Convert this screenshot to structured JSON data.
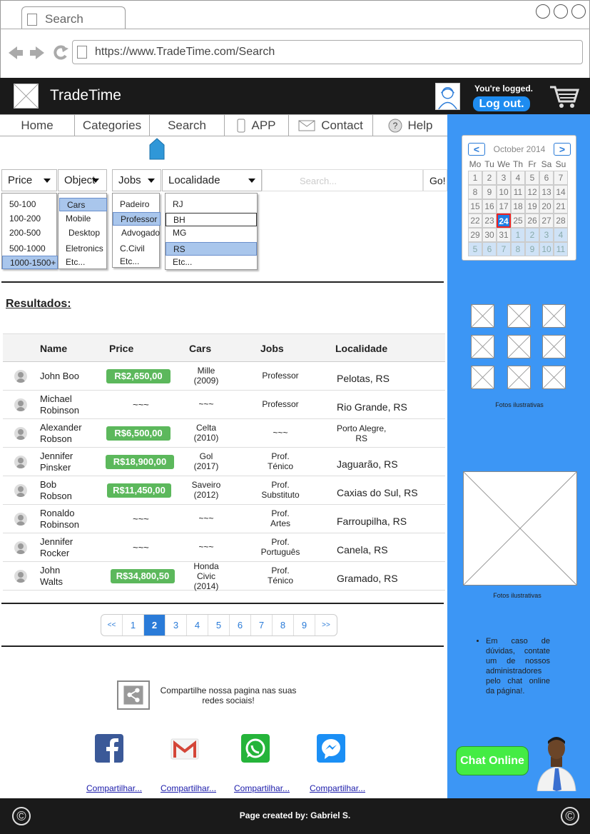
{
  "browser": {
    "tab_title": "Search",
    "url": "https://www.TradeTime.com/Search"
  },
  "header": {
    "brand": "TradeTime",
    "logged_text": "You're logged.",
    "logout_label": "Log out."
  },
  "menu": [
    {
      "label": "Home",
      "icon": ""
    },
    {
      "label": "Categories",
      "icon": ""
    },
    {
      "label": "Search",
      "icon": ""
    },
    {
      "label": "APP",
      "icon": "phone-icon"
    },
    {
      "label": "Contact",
      "icon": "envelope-icon"
    },
    {
      "label": "Help",
      "icon": "question-icon"
    }
  ],
  "filters": {
    "price": {
      "label": "Price",
      "options": [
        "50-100",
        "100-200",
        "200-500",
        "500-1000",
        "1000-1500+"
      ],
      "selected": "1000-1500+"
    },
    "object": {
      "label": "Object",
      "options": [
        "Cars",
        "Mobile",
        "Desktop",
        "Eletronics",
        "Etc..."
      ],
      "selected": "Cars"
    },
    "jobs": {
      "label": "Jobs",
      "options": [
        "Padeiro",
        "Professor",
        "Advogado",
        "C.Civil",
        "Etc..."
      ],
      "selected": "Professor"
    },
    "localidade": {
      "label": "Localidade",
      "options": [
        "RJ",
        "BH",
        "MG",
        "RS",
        "Etc..."
      ],
      "selected": "RS"
    },
    "search_placeholder": "Search...",
    "go_label": "Go!"
  },
  "results": {
    "title": "Resultados:",
    "columns": [
      "Name",
      "Price",
      "Cars",
      "Jobs",
      "Localidade"
    ],
    "rows": [
      {
        "name": "John Boo",
        "price": "R$2,650,00",
        "car": "Mille\n(2009)",
        "job": "Professor",
        "loc": "Pelotas, RS"
      },
      {
        "name": "Michael\nRobinson",
        "price": "~~~",
        "car": "~~~",
        "job": "Professor",
        "loc": "Rio Grande, RS"
      },
      {
        "name": "Alexander\nRobson",
        "price": "R$6,500,00",
        "car": "Celta\n(2010)",
        "job": "~~~",
        "loc": "Porto Alegre,\nRS"
      },
      {
        "name": "Jennifer\nPinsker",
        "price": "R$18,900,00",
        "car": "Gol\n(2017)",
        "job": "Prof.\nTénico",
        "loc": "Jaguarão, RS"
      },
      {
        "name": "Bob\nRobson",
        "price": "R$11,450,00",
        "car": "Saveiro\n(2012)",
        "job": "Prof.\nSubstituto",
        "loc": "Caxias do Sul, RS"
      },
      {
        "name": "Ronaldo\nRobinson",
        "price": "~~~",
        "car": "~~~",
        "job": "Prof.\nArtes",
        "loc": "Farroupilha, RS"
      },
      {
        "name": "Jennifer\nRocker",
        "price": "~~~",
        "car": "~~~",
        "job": "Prof.\nPortuguês",
        "loc": "Canela, RS"
      },
      {
        "name": "John\nWalts",
        "price": "R$34,800,50",
        "car": "Honda\nCivic\n(2014)",
        "job": "Prof.\nTénico",
        "loc": "Gramado, RS"
      }
    ]
  },
  "pagination": {
    "first": "<<",
    "last": ">>",
    "pages": [
      "1",
      "2",
      "3",
      "4",
      "5",
      "6",
      "7",
      "8",
      "9"
    ],
    "active": "2"
  },
  "share": {
    "text": "Compartilhe nossa pagina nas suas redes sociais!",
    "networks": [
      {
        "name": "facebook-icon",
        "color": "#3b5998",
        "link": "Compartilhar..."
      },
      {
        "name": "gmail-icon",
        "color": "#ffffff",
        "link": "Compartilhar..."
      },
      {
        "name": "whatsapp-icon",
        "color": "#25d366",
        "link": "Compartilhar..."
      },
      {
        "name": "messenger-icon",
        "color": "#0084ff",
        "link": "Compartilhar..."
      }
    ]
  },
  "calendar": {
    "month": "October 2014",
    "prev": "<",
    "next": ">",
    "dow": [
      "Mo",
      "Tu",
      "We",
      "Th",
      "Fr",
      "Sa",
      "Su"
    ],
    "days": [
      "1",
      "2",
      "3",
      "4",
      "5",
      "6",
      "7",
      "8",
      "9",
      "10",
      "11",
      "12",
      "13",
      "14",
      "15",
      "16",
      "17",
      "18",
      "19",
      "20",
      "21",
      "22",
      "23",
      "24",
      "25",
      "26",
      "27",
      "28",
      "29",
      "30",
      "31",
      "1",
      "2",
      "3",
      "4",
      "5",
      "6",
      "7",
      "8",
      "9",
      "10",
      "11"
    ],
    "today": "24"
  },
  "sidebar": {
    "photos_caption": "Fotos ilustrativas",
    "photo_caption_2": "Fotos ilustrativas",
    "help": "Em caso de dúvidas, contate um de nossos administradores pelo chat online da página!.",
    "chat_label": "Chat Online"
  },
  "footer": {
    "text": "Page created by: Gabriel S."
  },
  "colors": {
    "accent": "#3c96f5",
    "header": "#1a1a1a",
    "price": "#5cb85c",
    "chat": "#44ec44",
    "logout": "#1e8cf0"
  }
}
